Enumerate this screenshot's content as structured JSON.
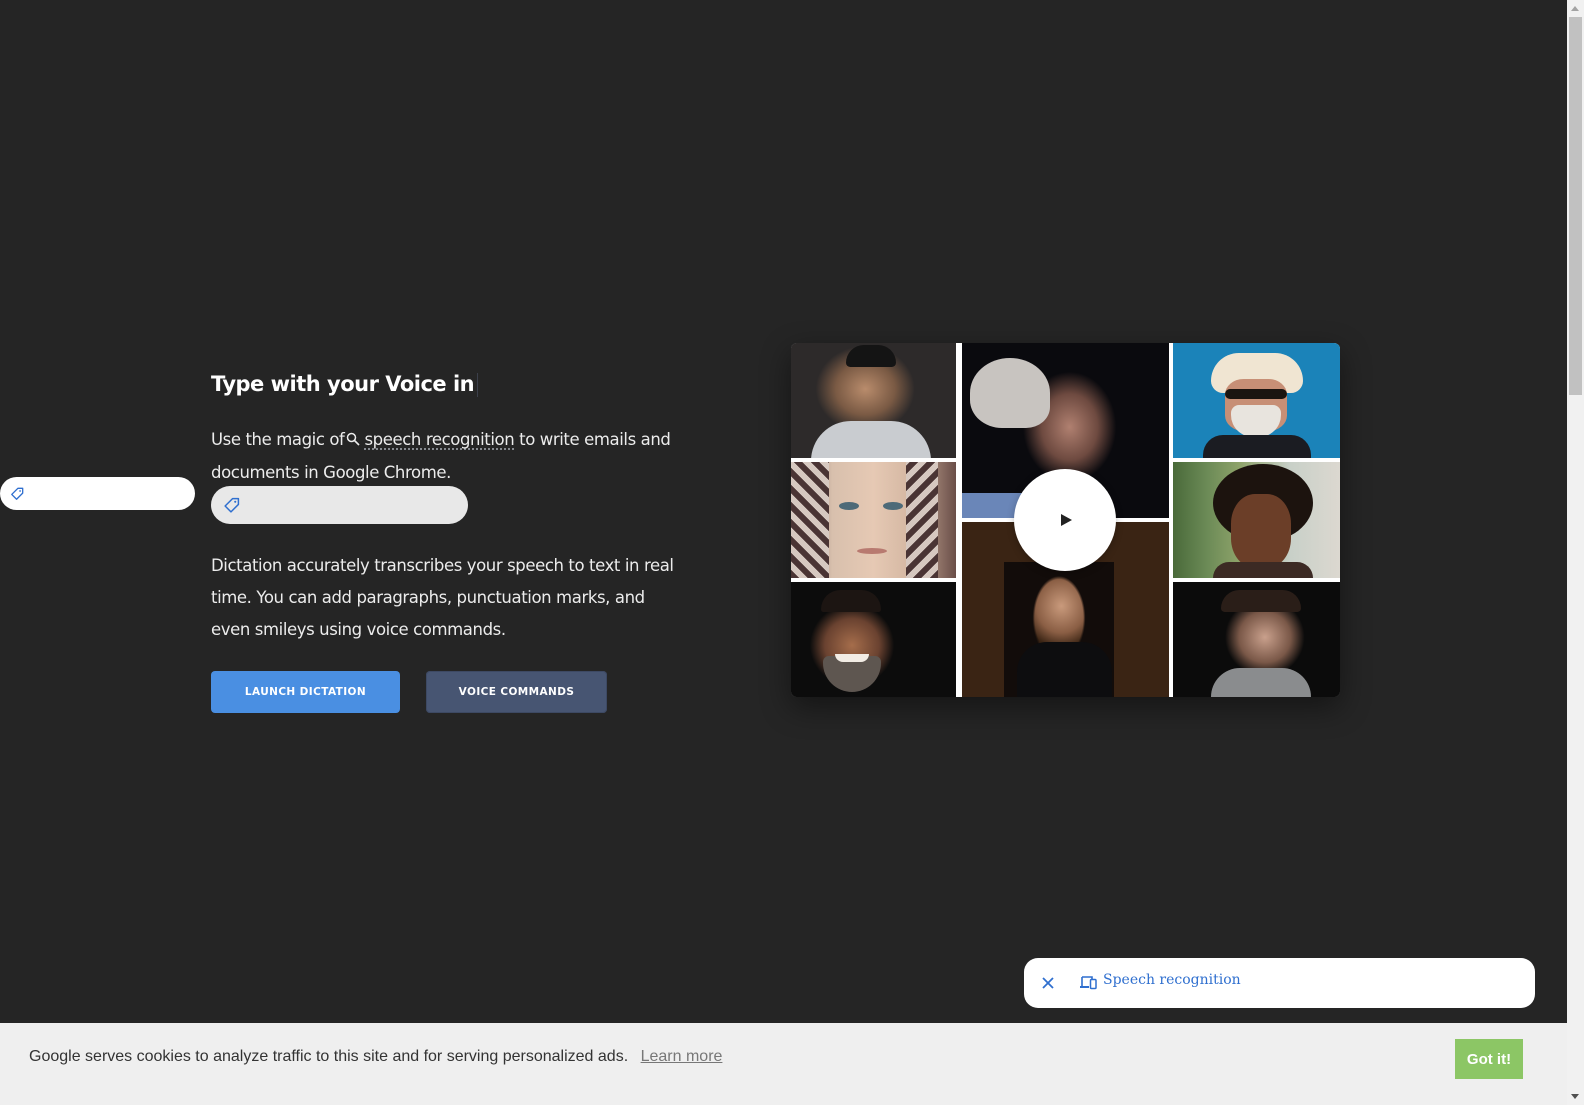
{
  "hero": {
    "title": "Type with your Voice in",
    "intro_before_link": "Use the magic of",
    "intro_link": "speech recognition",
    "intro_after_link": " to write emails and documents in Google Chrome.",
    "description": "Dictation accurately transcribes your speech to text in real time. You can add paragraphs, punctuation marks, and even smileys using voice commands."
  },
  "tag_inputs": [
    {
      "icon": "tag-icon",
      "value": ""
    },
    {
      "icon": "tag-icon",
      "value": ""
    }
  ],
  "buttons": {
    "launch_label": "LAUNCH DICTATION",
    "voice_commands_label": "VOICE COMMANDS"
  },
  "video": {
    "play_icon": "play-icon",
    "thumbnails": [
      "young man in white shirt",
      "elderly man in profile",
      "man in white cowboy hat and sunglasses",
      "woman in patterned headscarf",
      "woman with curly hair outdoors",
      "smiling bearded man",
      "woman in black turtleneck",
      "man in grey hoodie"
    ]
  },
  "toast": {
    "close_icon": "close-icon",
    "devices_icon": "devices-icon",
    "label": "Speech recognition"
  },
  "cookie_bar": {
    "message": "Google serves cookies to analyze traffic to this site and for serving personalized ads.",
    "learn_more": "Learn more",
    "accept": "Got it!"
  },
  "colors": {
    "background": "#252525",
    "primary_button": "#4a8fe2",
    "secondary_button": "#475572",
    "accept_button": "#8cc665",
    "link_blue": "#2f6fcf"
  }
}
